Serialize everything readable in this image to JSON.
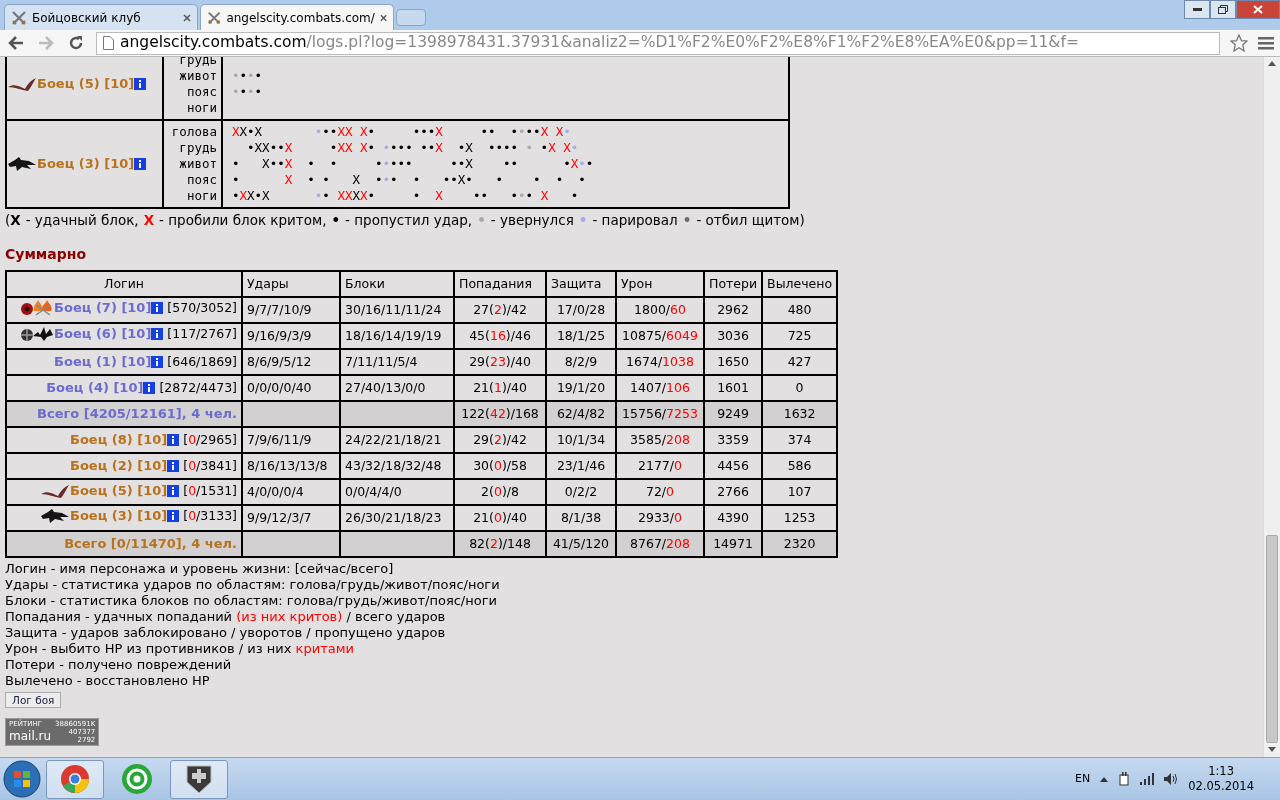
{
  "browser": {
    "tabs": [
      {
        "title": "Бойцовский клуб",
        "selected": false
      },
      {
        "title": "angelscity.combats.com/",
        "selected": true
      }
    ],
    "forward_disabled": true,
    "address": {
      "host": "angelscity.combats.com",
      "path": "/logs.pl?log=1398978431.37931&analiz2=%D1%F2%E0%F2%E8%F1%F2%E8%EA%E0&pp=11&f="
    }
  },
  "log_table": {
    "rows": [
      {
        "name": "Боец (5) [10]",
        "color": "#b8721c",
        "lines": [
          {
            "zone": "грудь"
          },
          {
            "zone": "живот",
            "marks": [
              {
                "t": "•",
                "color": "#aaaaaa"
              },
              {
                "t": "•"
              },
              {
                "t": "•",
                "color": "#aaaaaa"
              },
              {
                "t": "•"
              }
            ]
          },
          {
            "zone": "пояс",
            "marks": [
              {
                "t": "•",
                "color": "#aaaaaa"
              },
              {
                "t": "•"
              },
              {
                "t": "•",
                "color": "#aaaaaa"
              },
              {
                "t": "•"
              }
            ]
          },
          {
            "zone": "ноги"
          }
        ]
      },
      {
        "name": "Боец (3) [10]",
        "color": "#b8721c",
        "lines": [
          {
            "zone": "голова",
            "marks": [
              {
                "t": "X",
                "color": "#ff0000"
              },
              {
                "t": "X•X       "
              },
              {
                "t": "•",
                "color": "#a8a8f0"
              },
              {
                "t": "••"
              },
              {
                "t": "XX X",
                "color": "#ff0000"
              },
              {
                "t": "•     •••"
              },
              {
                "t": "X",
                "color": "#ff0000"
              },
              {
                "t": "     ••  •"
              },
              {
                "t": "•",
                "color": "#aaaaaa"
              },
              {
                "t": "••"
              },
              {
                "t": "X X",
                "color": "#ff0000"
              },
              {
                "t": "•",
                "color": "#a8a8f0"
              }
            ]
          },
          {
            "zone": "грудь",
            "marks": [
              {
                "t": "  •XX••"
              },
              {
                "t": "X",
                "color": "#ff0000"
              },
              {
                "t": "     •"
              },
              {
                "t": "XX X",
                "color": "#ff0000"
              },
              {
                "t": "• "
              },
              {
                "t": "•",
                "color": "#a8a8f0"
              },
              {
                "t": "••• ••"
              },
              {
                "t": "X",
                "color": "#ff0000"
              },
              {
                "t": "  •X  •••• "
              },
              {
                "t": "•",
                "color": "#aaaaaa"
              },
              {
                "t": " •"
              },
              {
                "t": "X X",
                "color": "#ff0000"
              },
              {
                "t": "•",
                "color": "#a8a8f0"
              }
            ]
          },
          {
            "zone": "живот",
            "marks": [
              {
                "t": "•   X••"
              },
              {
                "t": "X",
                "color": "#ff0000"
              },
              {
                "t": "  •  •     •"
              },
              {
                "t": "•",
                "color": "#a8a8f0"
              },
              {
                "t": "•••     ••X    ••      •"
              },
              {
                "t": "X",
                "color": "#ff0000"
              },
              {
                "t": "•",
                "color": "#a8a8f0"
              },
              {
                "t": "•"
              }
            ]
          },
          {
            "zone": "пояс",
            "marks": [
              {
                "t": "•      "
              },
              {
                "t": "X",
                "color": "#ff0000"
              },
              {
                "t": "  • •   X  •"
              },
              {
                "t": "•",
                "color": "#a8a8f0"
              },
              {
                "t": "•  •   ••X•   •    •  •  •"
              }
            ]
          },
          {
            "zone": "ноги",
            "marks": [
              {
                "t": "•"
              },
              {
                "t": "X",
                "color": "#ff0000"
              },
              {
                "t": "X•X      "
              },
              {
                "t": "•",
                "color": "#a8a8f0"
              },
              {
                "t": "• "
              },
              {
                "t": "XX",
                "color": "#ff0000"
              },
              {
                "t": "X"
              },
              {
                "t": "X",
                "color": "#ff0000"
              },
              {
                "t": "•     •  "
              },
              {
                "t": "X",
                "color": "#ff0000"
              },
              {
                "t": "    ••   •"
              },
              {
                "t": "•",
                "color": "#aaaaaa"
              },
              {
                "t": "• "
              },
              {
                "t": "X",
                "color": "#ff0000"
              },
              {
                "t": "   •"
              }
            ]
          }
        ]
      }
    ]
  },
  "legend": {
    "open": "(",
    "close": ")",
    "items": [
      {
        "symbol": "X",
        "color": "#000000",
        "text": "- удачный блок,"
      },
      {
        "symbol": "X",
        "color": "#ff0000",
        "text": "- пробили блок критом,"
      },
      {
        "symbol": "•",
        "color": "#000000",
        "text": "- пропустил удар,"
      },
      {
        "symbol": "•",
        "color": "#aaaaaa",
        "text": "- увернулся"
      },
      {
        "symbol": "•",
        "color": "#a8a8f0",
        "text": "- парировал"
      },
      {
        "symbol": "•",
        "color": "#6c6c6c",
        "text": "- отбил щитом"
      }
    ]
  },
  "summary": {
    "title": "Суммарно",
    "columns": [
      "Логин",
      "Удары",
      "Блоки",
      "Попадания",
      "Защита",
      "Урон",
      "Потери",
      "Вылечено"
    ],
    "rows": [
      {
        "kind": "fighter",
        "color": "#6b6bd0",
        "name": "Боец (7) [10]",
        "hp": [
          {
            "t": "[570/3052]"
          }
        ],
        "strikes": "9/7/7/10/9",
        "blocks": "30/16/11/11/24",
        "hits": [
          {
            "t": "27("
          },
          {
            "t": "2",
            "crit": true
          },
          {
            "t": ")/42"
          }
        ],
        "defense": "17/0/28",
        "damage": [
          {
            "t": "1800/"
          },
          {
            "t": "60",
            "crit": true
          }
        ],
        "losses": "2962",
        "healed": "480"
      },
      {
        "kind": "fighter",
        "color": "#6b6bd0",
        "name": "Боец (6) [10]",
        "hp": [
          {
            "t": "[117/2767]"
          }
        ],
        "strikes": "9/16/9/3/9",
        "blocks": "18/16/14/19/19",
        "hits": [
          {
            "t": "45("
          },
          {
            "t": "16",
            "crit": true
          },
          {
            "t": ")/46"
          }
        ],
        "defense": "18/1/25",
        "damage": [
          {
            "t": "10875/"
          },
          {
            "t": "6049",
            "crit": true
          }
        ],
        "losses": "3036",
        "healed": "725"
      },
      {
        "kind": "fighter",
        "color": "#6b6bd0",
        "name": "Боец (1) [10]",
        "hp": [
          {
            "t": "[646/1869]"
          }
        ],
        "strikes": "8/6/9/5/12",
        "blocks": "7/11/11/5/4",
        "hits": [
          {
            "t": "29("
          },
          {
            "t": "23",
            "crit": true
          },
          {
            "t": ")/40"
          }
        ],
        "defense": "8/2/9",
        "damage": [
          {
            "t": "1674/"
          },
          {
            "t": "1038",
            "crit": true
          }
        ],
        "losses": "1650",
        "healed": "427"
      },
      {
        "kind": "fighter",
        "color": "#6b6bd0",
        "name": "Боец (4) [10]",
        "hp": [
          {
            "t": "[2872/4473]"
          }
        ],
        "strikes": "0/0/0/0/40",
        "blocks": "27/40/13/0/0",
        "hits": [
          {
            "t": "21("
          },
          {
            "t": "1",
            "crit": true
          },
          {
            "t": ")/40"
          }
        ],
        "defense": "19/1/20",
        "damage": [
          {
            "t": "1407/"
          },
          {
            "t": "106",
            "crit": true
          }
        ],
        "losses": "1601",
        "healed": "0"
      },
      {
        "kind": "total",
        "color": "#6b6bd0",
        "name": "Всего [4205/12161], 4 чел.",
        "hits": [
          {
            "t": "122("
          },
          {
            "t": "42",
            "crit": true
          },
          {
            "t": ")/168"
          }
        ],
        "defense": "62/4/82",
        "damage": [
          {
            "t": "15756/"
          },
          {
            "t": "7253",
            "crit": true
          }
        ],
        "losses": "9249",
        "healed": "1632"
      },
      {
        "kind": "fighter",
        "color": "#b8721c",
        "name": "Боец (8) [10]",
        "hp": [
          {
            "t": "["
          },
          {
            "t": "0",
            "crit": true
          },
          {
            "t": "/2965]"
          }
        ],
        "strikes": "7/9/6/11/9",
        "blocks": "24/22/21/18/21",
        "hits": [
          {
            "t": "29("
          },
          {
            "t": "2",
            "crit": true
          },
          {
            "t": ")/42"
          }
        ],
        "defense": "10/1/34",
        "damage": [
          {
            "t": "3585/"
          },
          {
            "t": "208",
            "crit": true
          }
        ],
        "losses": "3359",
        "healed": "374"
      },
      {
        "kind": "fighter",
        "color": "#b8721c",
        "name": "Боец (2) [10]",
        "hp": [
          {
            "t": "["
          },
          {
            "t": "0",
            "crit": true
          },
          {
            "t": "/3841]"
          }
        ],
        "strikes": "8/16/13/13/8",
        "blocks": "43/32/18/32/48",
        "hits": [
          {
            "t": "30("
          },
          {
            "t": "0",
            "crit": true
          },
          {
            "t": ")/58"
          }
        ],
        "defense": "23/1/46",
        "damage": [
          {
            "t": "2177/"
          },
          {
            "t": "0",
            "crit": true
          }
        ],
        "losses": "4456",
        "healed": "586"
      },
      {
        "kind": "fighter",
        "color": "#b8721c",
        "name": "Боец (5) [10]",
        "hp": [
          {
            "t": "["
          },
          {
            "t": "0",
            "crit": true
          },
          {
            "t": "/1531]"
          }
        ],
        "strikes": "4/0/0/0/4",
        "blocks": "0/0/4/4/0",
        "hits": [
          {
            "t": "2("
          },
          {
            "t": "0",
            "crit": true
          },
          {
            "t": ")/8"
          }
        ],
        "defense": "0/2/2",
        "damage": [
          {
            "t": "72/"
          },
          {
            "t": "0",
            "crit": true
          }
        ],
        "losses": "2766",
        "healed": "107"
      },
      {
        "kind": "fighter",
        "color": "#b8721c",
        "name": "Боец (3) [10]",
        "hp": [
          {
            "t": "["
          },
          {
            "t": "0",
            "crit": true
          },
          {
            "t": "/3133]"
          }
        ],
        "strikes": "9/9/12/3/7",
        "blocks": "26/30/21/18/23",
        "hits": [
          {
            "t": "21("
          },
          {
            "t": "0",
            "crit": true
          },
          {
            "t": ")/40"
          }
        ],
        "defense": "8/1/38",
        "damage": [
          {
            "t": "2933/"
          },
          {
            "t": "0",
            "crit": true
          }
        ],
        "losses": "4390",
        "healed": "1253"
      },
      {
        "kind": "total",
        "color": "#b8721c",
        "name": "Всего [0/11470], 4 чел.",
        "hits": [
          {
            "t": "82("
          },
          {
            "t": "2",
            "crit": true
          },
          {
            "t": ")/148"
          }
        ],
        "defense": "41/5/120",
        "damage": [
          {
            "t": "8767/"
          },
          {
            "t": "208",
            "crit": true
          }
        ],
        "losses": "14971",
        "healed": "2320"
      }
    ]
  },
  "notes": [
    [
      {
        "t": "Логин - имя персонажа и уровень жизни: [сейчас/всего]"
      }
    ],
    [
      {
        "t": "Удары - статистика ударов по областям: голова/грудь/живот/пояс/ноги"
      }
    ],
    [
      {
        "t": "Блоки - статистика блоков по областям: голова/грудь/живот/пояс/ноги"
      }
    ],
    [
      {
        "t": "Попадания - удачных попаданий "
      },
      {
        "t": "(из них критов)",
        "crit": true
      },
      {
        "t": " / всего ударов"
      }
    ],
    [
      {
        "t": "Защита - ударов заблокировано / уворотов / пропущено ударов"
      }
    ],
    [
      {
        "t": "Урон - выбито HP из противников / из них "
      },
      {
        "t": "критами",
        "crit": true
      }
    ],
    [
      {
        "t": "Потери - получено повреждений"
      }
    ],
    [
      {
        "t": "Вылечено - восстановлено HP"
      }
    ]
  ],
  "log_button": "Лог боя",
  "counter": {
    "label": "РЕЙТИНГ",
    "code": "38860591K",
    "brand": "mail.ru",
    "visits": "407377",
    "hosts": "2792"
  },
  "taskbar": {
    "apps": [
      {
        "running": true
      },
      {
        "running": false
      },
      {
        "running": true
      }
    ],
    "language": "EN",
    "time": "1:13",
    "date": "02.05.2014"
  }
}
